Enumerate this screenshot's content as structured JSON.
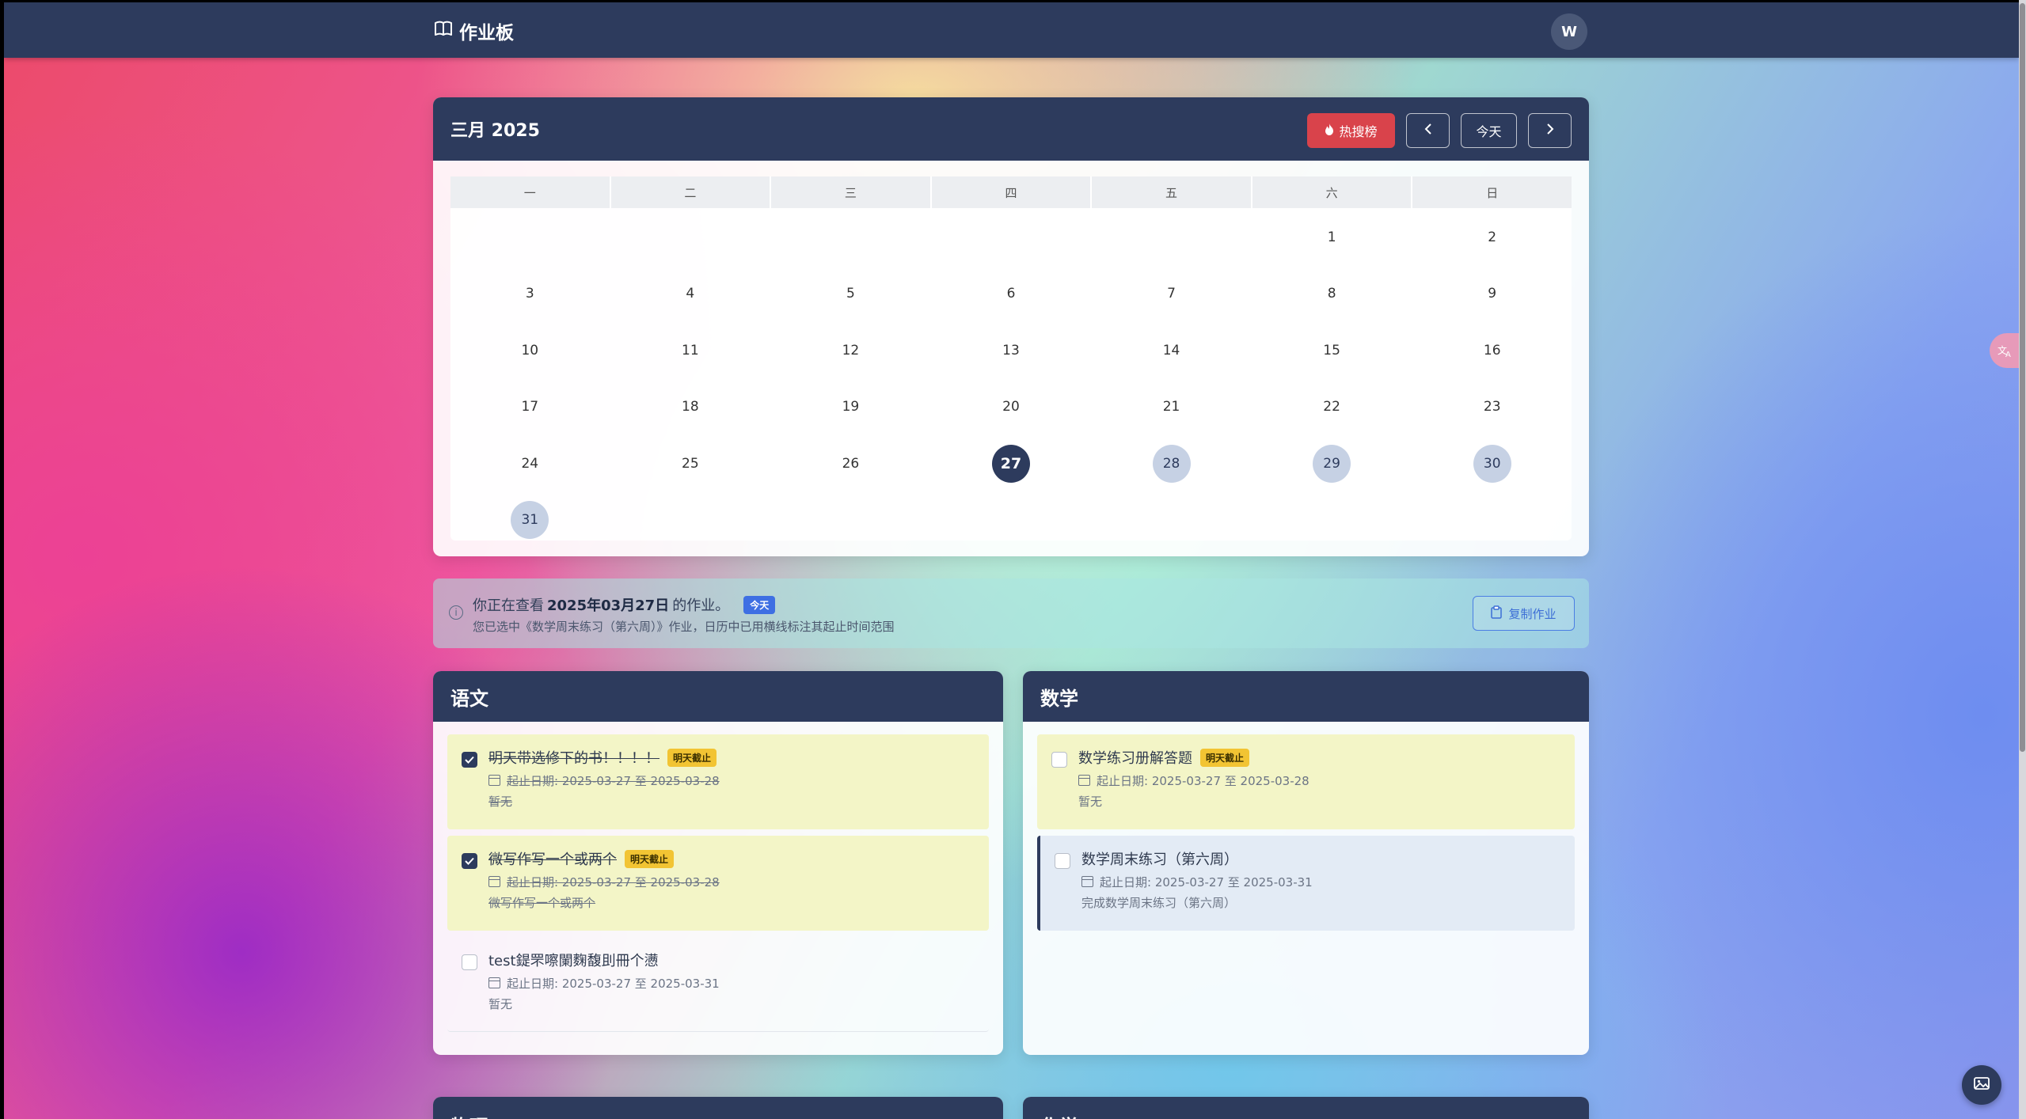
{
  "navbar": {
    "brand": "作业板",
    "avatar_initial": "W"
  },
  "calendar": {
    "title": "三月 2025",
    "hot_button": "热搜榜",
    "today_button": "今天",
    "weekdays": [
      "一",
      "二",
      "三",
      "四",
      "五",
      "六",
      "日"
    ],
    "days": [
      "",
      "",
      "",
      "",
      "",
      "1",
      "2",
      "3",
      "4",
      "5",
      "6",
      "7",
      "8",
      "9",
      "10",
      "11",
      "12",
      "13",
      "14",
      "15",
      "16",
      "17",
      "18",
      "19",
      "20",
      "21",
      "22",
      "23",
      "24",
      "25",
      "26",
      "27",
      "28",
      "29",
      "30",
      "31",
      "",
      "",
      "",
      "",
      "",
      ""
    ],
    "today": "27",
    "highlighted_range": [
      "28",
      "29",
      "30",
      "31"
    ]
  },
  "info": {
    "prefix": "你正在查看",
    "date": "2025年03月27日",
    "suffix": "的作业。",
    "today_badge": "今天",
    "note": "您已选中《数学周末练习（第六周）》作业，日历中已用横线标注其起止时间范围",
    "copy_button": "复制作业"
  },
  "subjects": [
    {
      "name": "语文",
      "tasks": [
        {
          "title": "明天带选修下的书！！！！",
          "badge": "明天截止",
          "date": "起止日期: 2025-03-27 至 2025-03-28",
          "desc": "暂无",
          "checked": true,
          "style": "yellow"
        },
        {
          "title": "微写作写一个或两个",
          "badge": "明天截止",
          "date": "起止日期: 2025-03-27 至 2025-03-28",
          "desc": "微写作写一个或两个",
          "checked": true,
          "style": "yellow"
        },
        {
          "title": "test鍉罘嚓闌麴馥刞冊个懑",
          "badge": "",
          "date": "起止日期: 2025-03-27 至 2025-03-31",
          "desc": "暂无",
          "checked": false,
          "style": "plain"
        }
      ]
    },
    {
      "name": "数学",
      "tasks": [
        {
          "title": "数学练习册解答题",
          "badge": "明天截止",
          "date": "起止日期: 2025-03-27 至 2025-03-28",
          "desc": "暂无",
          "checked": false,
          "style": "yellow"
        },
        {
          "title": "数学周末练习（第六周）",
          "badge": "",
          "date": "起止日期: 2025-03-27 至 2025-03-31",
          "desc": "完成数学周末练习（第六周）",
          "checked": false,
          "style": "blue"
        }
      ]
    },
    {
      "name": "物理"
    },
    {
      "name": "化学"
    }
  ],
  "colors": {
    "primary": "#2d3b5d",
    "hot": "#d9434b",
    "due_badge": "#f2c433",
    "today_badge": "#3e6fe3"
  }
}
